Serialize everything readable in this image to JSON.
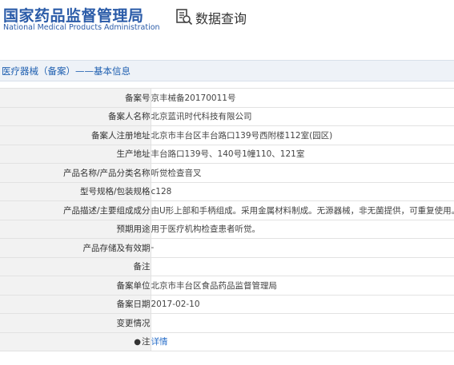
{
  "header": {
    "logo_cn": "国家药品监督管理局",
    "logo_en": "National Medical Products Administration",
    "query_title": "数据查询"
  },
  "section": {
    "title": "医疗器械（备案）——基本信息"
  },
  "rows": [
    {
      "label": "备案号",
      "value": "京丰械备20170011号"
    },
    {
      "label": "备案人名称",
      "value": "北京蓝讯时代科技有限公司"
    },
    {
      "label": "备案人注册地址",
      "value": "北京市丰台区丰台路口139号西附楼112室(园区)"
    },
    {
      "label": "生产地址",
      "value": "丰台路口139号、140号1幢110、121室"
    },
    {
      "label": "产品名称/产品分类名称",
      "value": "听觉检查音叉"
    },
    {
      "label": "型号规格/包装规格",
      "value": "c128"
    },
    {
      "label": "产品描述/主要组成成分",
      "value": "由U形上部和手柄组成。采用金属材料制成。无源器械，非无菌提供，可重复使用。"
    },
    {
      "label": "预期用途",
      "value": "用于医疗机构检查患者听觉。"
    },
    {
      "label": "产品存储及有效期",
      "value": "-"
    },
    {
      "label": "备注",
      "value": ""
    },
    {
      "label": "备案单位",
      "value": "北京市丰台区食品药品监督管理局"
    },
    {
      "label": "备案日期",
      "value": "2017-02-10"
    },
    {
      "label": "变更情况",
      "value": ""
    },
    {
      "label": "注",
      "value": "详情"
    }
  ],
  "colors": {
    "brand_blue": "#2a5ba8",
    "link_blue": "#2a6fc9",
    "label_bg": "#f2f2f2",
    "section_bg": "#eef2f7"
  },
  "icons": {
    "query": "search-document-icon",
    "note": "bulb-icon"
  }
}
